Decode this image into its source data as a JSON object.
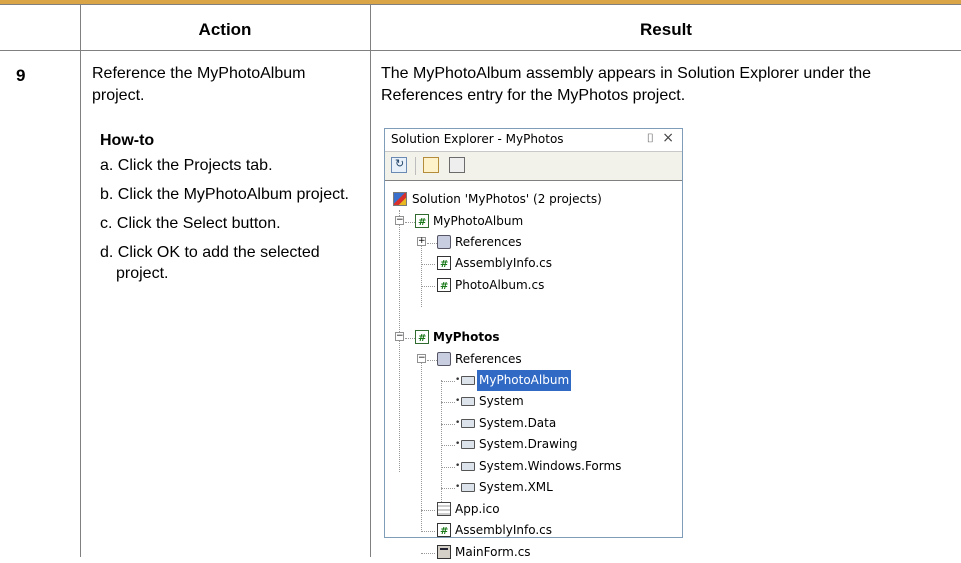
{
  "table": {
    "header_action": "Action",
    "header_result": "Result",
    "step_number": "9",
    "action_text": "Reference the MyPhotoAlbum project.",
    "howto_title": "How-to",
    "howto_steps": [
      "a. Click the Projects tab.",
      "b. Click the MyPhotoAlbum project.",
      "c. Click the Select button.",
      "d. Click OK to add the selected project."
    ],
    "result_text": "The MyPhotoAlbum assembly appears in Solution Explorer under the References entry for the MyPhotos project."
  },
  "solution_explorer": {
    "title": "Solution Explorer - MyPhotos",
    "pin_glyph": "⌷",
    "close_glyph": "×",
    "tree": {
      "solution": "Solution 'MyPhotos' (2 projects)",
      "myphotoalbum": "MyPhotoAlbum",
      "mpa_references": "References",
      "mpa_assemblyinfo": "AssemblyInfo.cs",
      "mpa_photoalbum": "PhotoAlbum.cs",
      "myphotos": "MyPhotos",
      "mp_references": "References",
      "ref_myphotoalbum": "MyPhotoAlbum",
      "ref_system": "System",
      "ref_system_data": "System.Data",
      "ref_system_drawing": "System.Drawing",
      "ref_system_windows_forms": "System.Windows.Forms",
      "ref_system_xml": "System.XML",
      "app_ico": "App.ico",
      "mp_assemblyinfo": "AssemblyInfo.cs",
      "mainform": "MainForm.cs"
    }
  },
  "colors": {
    "top_rule": "#d9a547",
    "selection": "#316ac5"
  }
}
